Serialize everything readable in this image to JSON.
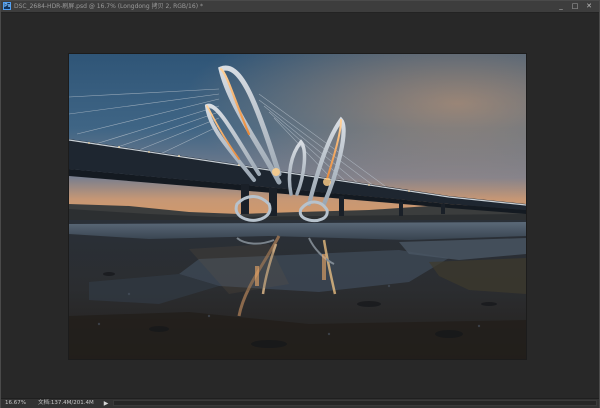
{
  "window": {
    "title": "DSC_2684-HDR-刷屏.psd @ 16.7% (Longdong 拷贝 2, RGB/16) *",
    "app_icon_label": "Ps",
    "controls": {
      "minimize": "_",
      "maximize": "□",
      "close": "✕"
    }
  },
  "document": {
    "subject": "bridge-at-dusk-photo"
  },
  "status": {
    "zoom": "16.67%",
    "doc_info": "文档:137.4M/201.4M",
    "arrow": "▶"
  },
  "colors": {
    "window_bg": "#282828",
    "titlebar_bg": "#3d3d3d",
    "statusbar_bg": "#323232"
  }
}
